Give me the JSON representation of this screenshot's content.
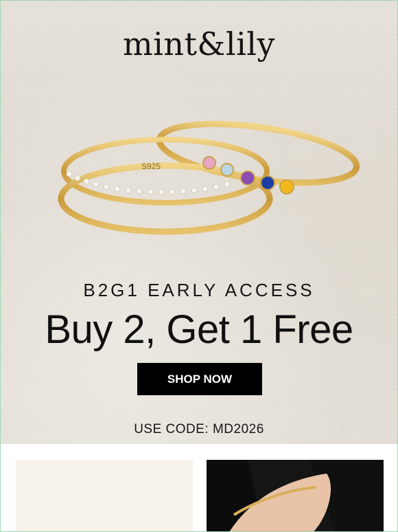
{
  "brand": {
    "logo_text": "mint&lily"
  },
  "hero": {
    "eyebrow": "B2G1 EARLY ACCESS",
    "headline": "Buy 2, Get 1 Free",
    "cta_label": "SHOP NOW",
    "promo_code": "USE CODE: MD2026",
    "ring_stamp": "S925"
  },
  "colors": {
    "background": "#e6e1d8",
    "cta_background": "#000000",
    "cta_text": "#ffffff",
    "gold": "#c9a24a",
    "border_accent": "#9fd7b3"
  },
  "products": [
    {
      "image": "product-image-left"
    },
    {
      "image": "bracelet-on-wrist-image"
    }
  ]
}
